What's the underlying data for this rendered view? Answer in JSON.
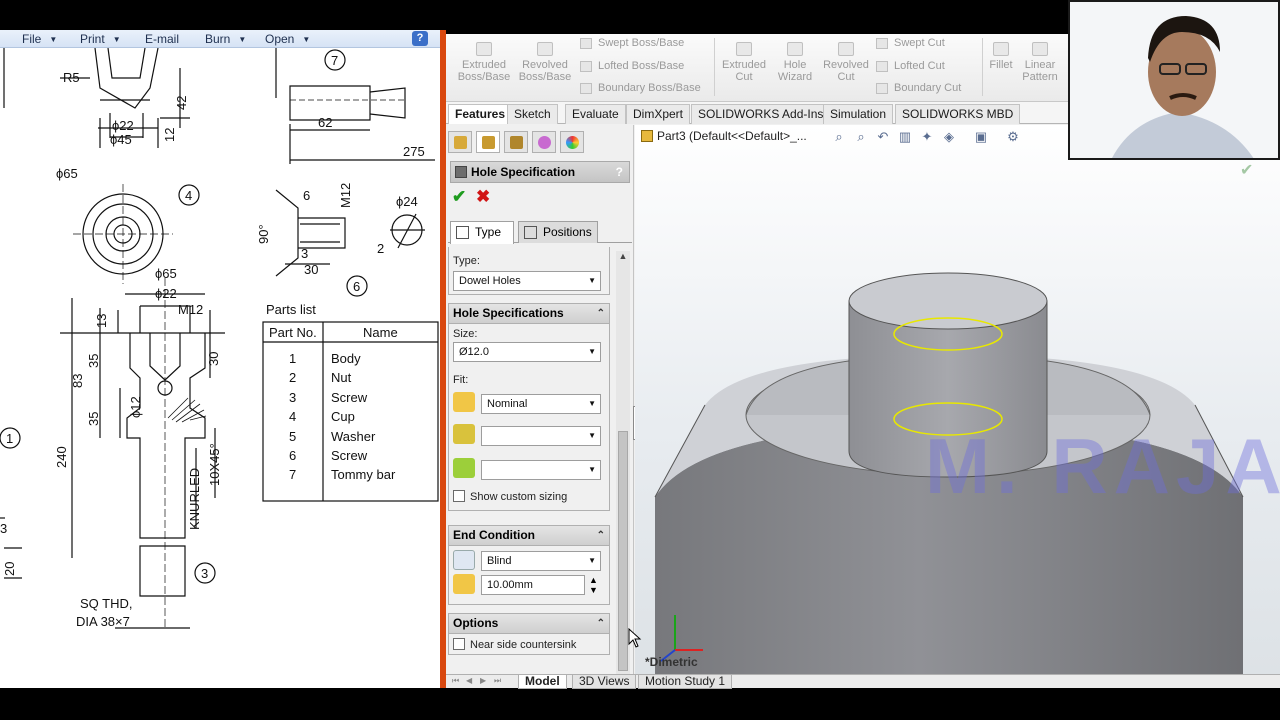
{
  "viewer": {
    "menu": [
      {
        "label": "File",
        "icon": "chevron-down-icon"
      },
      {
        "label": "Print",
        "icon": "chevron-down-icon"
      },
      {
        "label": "E-mail"
      },
      {
        "label": "Burn",
        "icon": "chevron-down-icon"
      },
      {
        "label": "Open",
        "icon": "chevron-down-icon"
      }
    ],
    "help_icon": "?"
  },
  "drawing": {
    "dims": [
      "R5",
      "42",
      "ϕ22",
      "ϕ45",
      "12",
      "ϕ65",
      "4",
      "7",
      "62",
      "275",
      "6",
      "M12",
      "ϕ24",
      "90°",
      "3",
      "30",
      "2",
      "6",
      "ϕ65",
      "ϕ22",
      "M12",
      "13",
      "35",
      "30",
      "83",
      "35",
      "ϕ12",
      "240",
      "KNURLED",
      "10X45°",
      "1",
      "3",
      "20",
      "3",
      "SQ THD,",
      "DIA 38×7"
    ],
    "parts_list_title": "Parts list",
    "parts_headers": [
      "Part No.",
      "Name"
    ],
    "parts": [
      {
        "no": "1",
        "name": "Body"
      },
      {
        "no": "2",
        "name": "Nut"
      },
      {
        "no": "3",
        "name": "Screw"
      },
      {
        "no": "4",
        "name": "Cup"
      },
      {
        "no": "5",
        "name": "Washer"
      },
      {
        "no": "6",
        "name": "Screw"
      },
      {
        "no": "7",
        "name": "Tommy bar"
      }
    ]
  },
  "ribbon": {
    "large": [
      {
        "label1": "Extruded",
        "label2": "Boss/Base"
      },
      {
        "label1": "Revolved",
        "label2": "Boss/Base"
      },
      {
        "label1": "Extruded",
        "label2": "Cut"
      },
      {
        "label1": "Hole",
        "label2": "Wizard"
      },
      {
        "label1": "Revolved",
        "label2": "Cut"
      },
      {
        "label1": "Fillet",
        "label2": ""
      },
      {
        "label1": "Linear",
        "label2": "Pattern"
      }
    ],
    "small_boss": [
      "Swept Boss/Base",
      "Lofted Boss/Base",
      "Boundary Boss/Base"
    ],
    "small_cut": [
      "Swept Cut",
      "Lofted Cut",
      "Boundary Cut"
    ]
  },
  "tabs": [
    "Features",
    "Sketch",
    "Evaluate",
    "DimXpert",
    "SOLIDWORKS Add-Ins",
    "Simulation",
    "SOLIDWORKS MBD"
  ],
  "property_manager": {
    "title": "Hole Specification",
    "help": "?",
    "ok_icon": "check-icon",
    "cancel_icon": "close-icon",
    "subtabs": [
      "Type",
      "Positions"
    ],
    "type_label": "Type:",
    "type_value": "Dowel Holes",
    "hole_spec_header": "Hole Specifications",
    "size_label": "Size:",
    "size_value": "Ø12.0",
    "fit_label": "Fit:",
    "fit_value": "Nominal",
    "fit_value2": "",
    "fit_value3": "",
    "show_custom_sizing": "Show custom sizing",
    "end_condition_header": "End Condition",
    "end_condition_value": "Blind",
    "depth_value": "10.00mm",
    "options_header": "Options",
    "near_side_countersink": "Near side countersink"
  },
  "graphics": {
    "tree_text": "Part3  (Default<<Default>_...",
    "view_label": "*Dimetric",
    "watermark": "M. RAJA ROY"
  },
  "bottom_tabs": [
    "Model",
    "3D Views",
    "Motion Study 1"
  ],
  "colors": {
    "accent_divider": "#d9480f",
    "hole_edge": "#e8e800",
    "ok": "#1f9c1f",
    "cancel": "#d11414"
  }
}
